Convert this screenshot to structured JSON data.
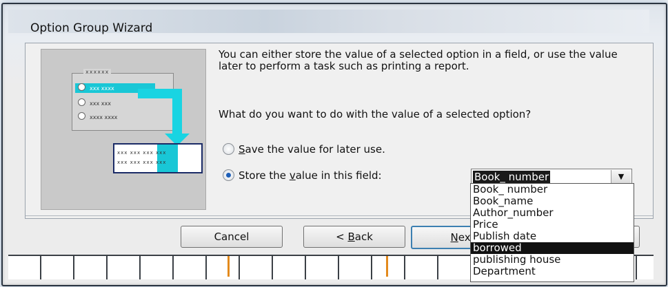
{
  "window": {
    "title": "Option Group Wizard"
  },
  "picture": {
    "group_label": "xxxxxx",
    "options": [
      "xxx xxxx",
      "xxx xxx",
      "xxxx xxxx"
    ],
    "table_rows": [
      "xxx xxx xxx xxx",
      "xxx xxx xxx xxx"
    ]
  },
  "instructions": {
    "intro": "You can either store the value of a selected option in a field, or use the value later to perform a task such as printing a report.",
    "question": "What do you want to do with the value of a selected option?"
  },
  "options": {
    "save": {
      "prefix": "",
      "hotkey": "S",
      "suffix": "ave the value for later use.",
      "checked": false
    },
    "store": {
      "prefix": "Store the ",
      "hotkey": "v",
      "suffix": "alue in this field:",
      "checked": true
    }
  },
  "field_combo": {
    "value": "Book_ number",
    "dropdown_glyph": "▼",
    "items": [
      "Book_ number",
      "Book_name",
      "Author_number",
      "Price",
      "Publish date",
      "borrowed",
      "publishing house",
      "Department"
    ],
    "highlighted_index": 5
  },
  "buttons": {
    "cancel": "Cancel",
    "back_prefix": "< ",
    "back_hotkey": "B",
    "back_suffix": "ack",
    "next_hotkey": "N",
    "next_suffix": "ext"
  },
  "colors": {
    "accent": "#19c7d6",
    "frame": "#2a3440",
    "selection": "#111111"
  }
}
